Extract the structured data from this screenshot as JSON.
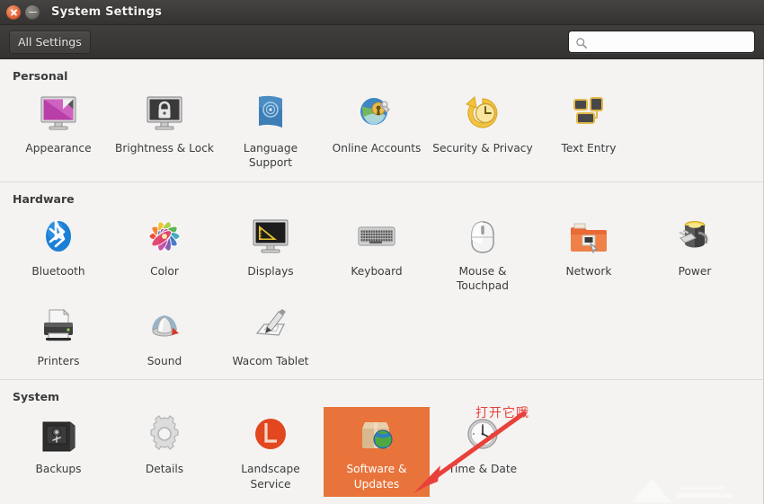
{
  "window": {
    "title": "System Settings",
    "close_icon": "close-icon",
    "minimize_icon": "minimize-icon"
  },
  "toolbar": {
    "all_settings_label": "All Settings",
    "search_icon": "search-icon",
    "search_value": "",
    "search_placeholder": ""
  },
  "sections": [
    {
      "title": "Personal",
      "items": [
        {
          "label": "Appearance",
          "icon": "appearance-icon",
          "selected": false
        },
        {
          "label": "Brightness & Lock",
          "icon": "brightness-lock-icon",
          "selected": false
        },
        {
          "label": "Language Support",
          "icon": "language-support-icon",
          "selected": false
        },
        {
          "label": "Online Accounts",
          "icon": "online-accounts-icon",
          "selected": false
        },
        {
          "label": "Security & Privacy",
          "icon": "security-privacy-icon",
          "selected": false
        },
        {
          "label": "Text Entry",
          "icon": "text-entry-icon",
          "selected": false
        }
      ]
    },
    {
      "title": "Hardware",
      "items": [
        {
          "label": "Bluetooth",
          "icon": "bluetooth-icon",
          "selected": false
        },
        {
          "label": "Color",
          "icon": "color-icon",
          "selected": false
        },
        {
          "label": "Displays",
          "icon": "displays-icon",
          "selected": false
        },
        {
          "label": "Keyboard",
          "icon": "keyboard-icon",
          "selected": false
        },
        {
          "label": "Mouse & Touchpad",
          "icon": "mouse-touchpad-icon",
          "selected": false
        },
        {
          "label": "Network",
          "icon": "network-icon",
          "selected": false
        },
        {
          "label": "Power",
          "icon": "power-icon",
          "selected": false
        },
        {
          "label": "Printers",
          "icon": "printers-icon",
          "selected": false
        },
        {
          "label": "Sound",
          "icon": "sound-icon",
          "selected": false
        },
        {
          "label": "Wacom Tablet",
          "icon": "wacom-tablet-icon",
          "selected": false
        }
      ]
    },
    {
      "title": "System",
      "items": [
        {
          "label": "Backups",
          "icon": "backups-icon",
          "selected": false
        },
        {
          "label": "Details",
          "icon": "details-icon",
          "selected": false
        },
        {
          "label": "Landscape Service",
          "icon": "landscape-service-icon",
          "selected": false
        },
        {
          "label": "Software & Updates",
          "icon": "software-updates-icon",
          "selected": true
        },
        {
          "label": "Time & Date",
          "icon": "time-date-icon",
          "selected": false
        }
      ]
    }
  ],
  "annotation": {
    "text": "打开它哦",
    "color": "#e8413a",
    "arrow_icon": "red-arrow-icon"
  },
  "colors": {
    "selection": "#e8743b",
    "titlebar": "#3c3b39",
    "content_bg": "#f4f3f2",
    "annotation_red": "#e8413a"
  }
}
